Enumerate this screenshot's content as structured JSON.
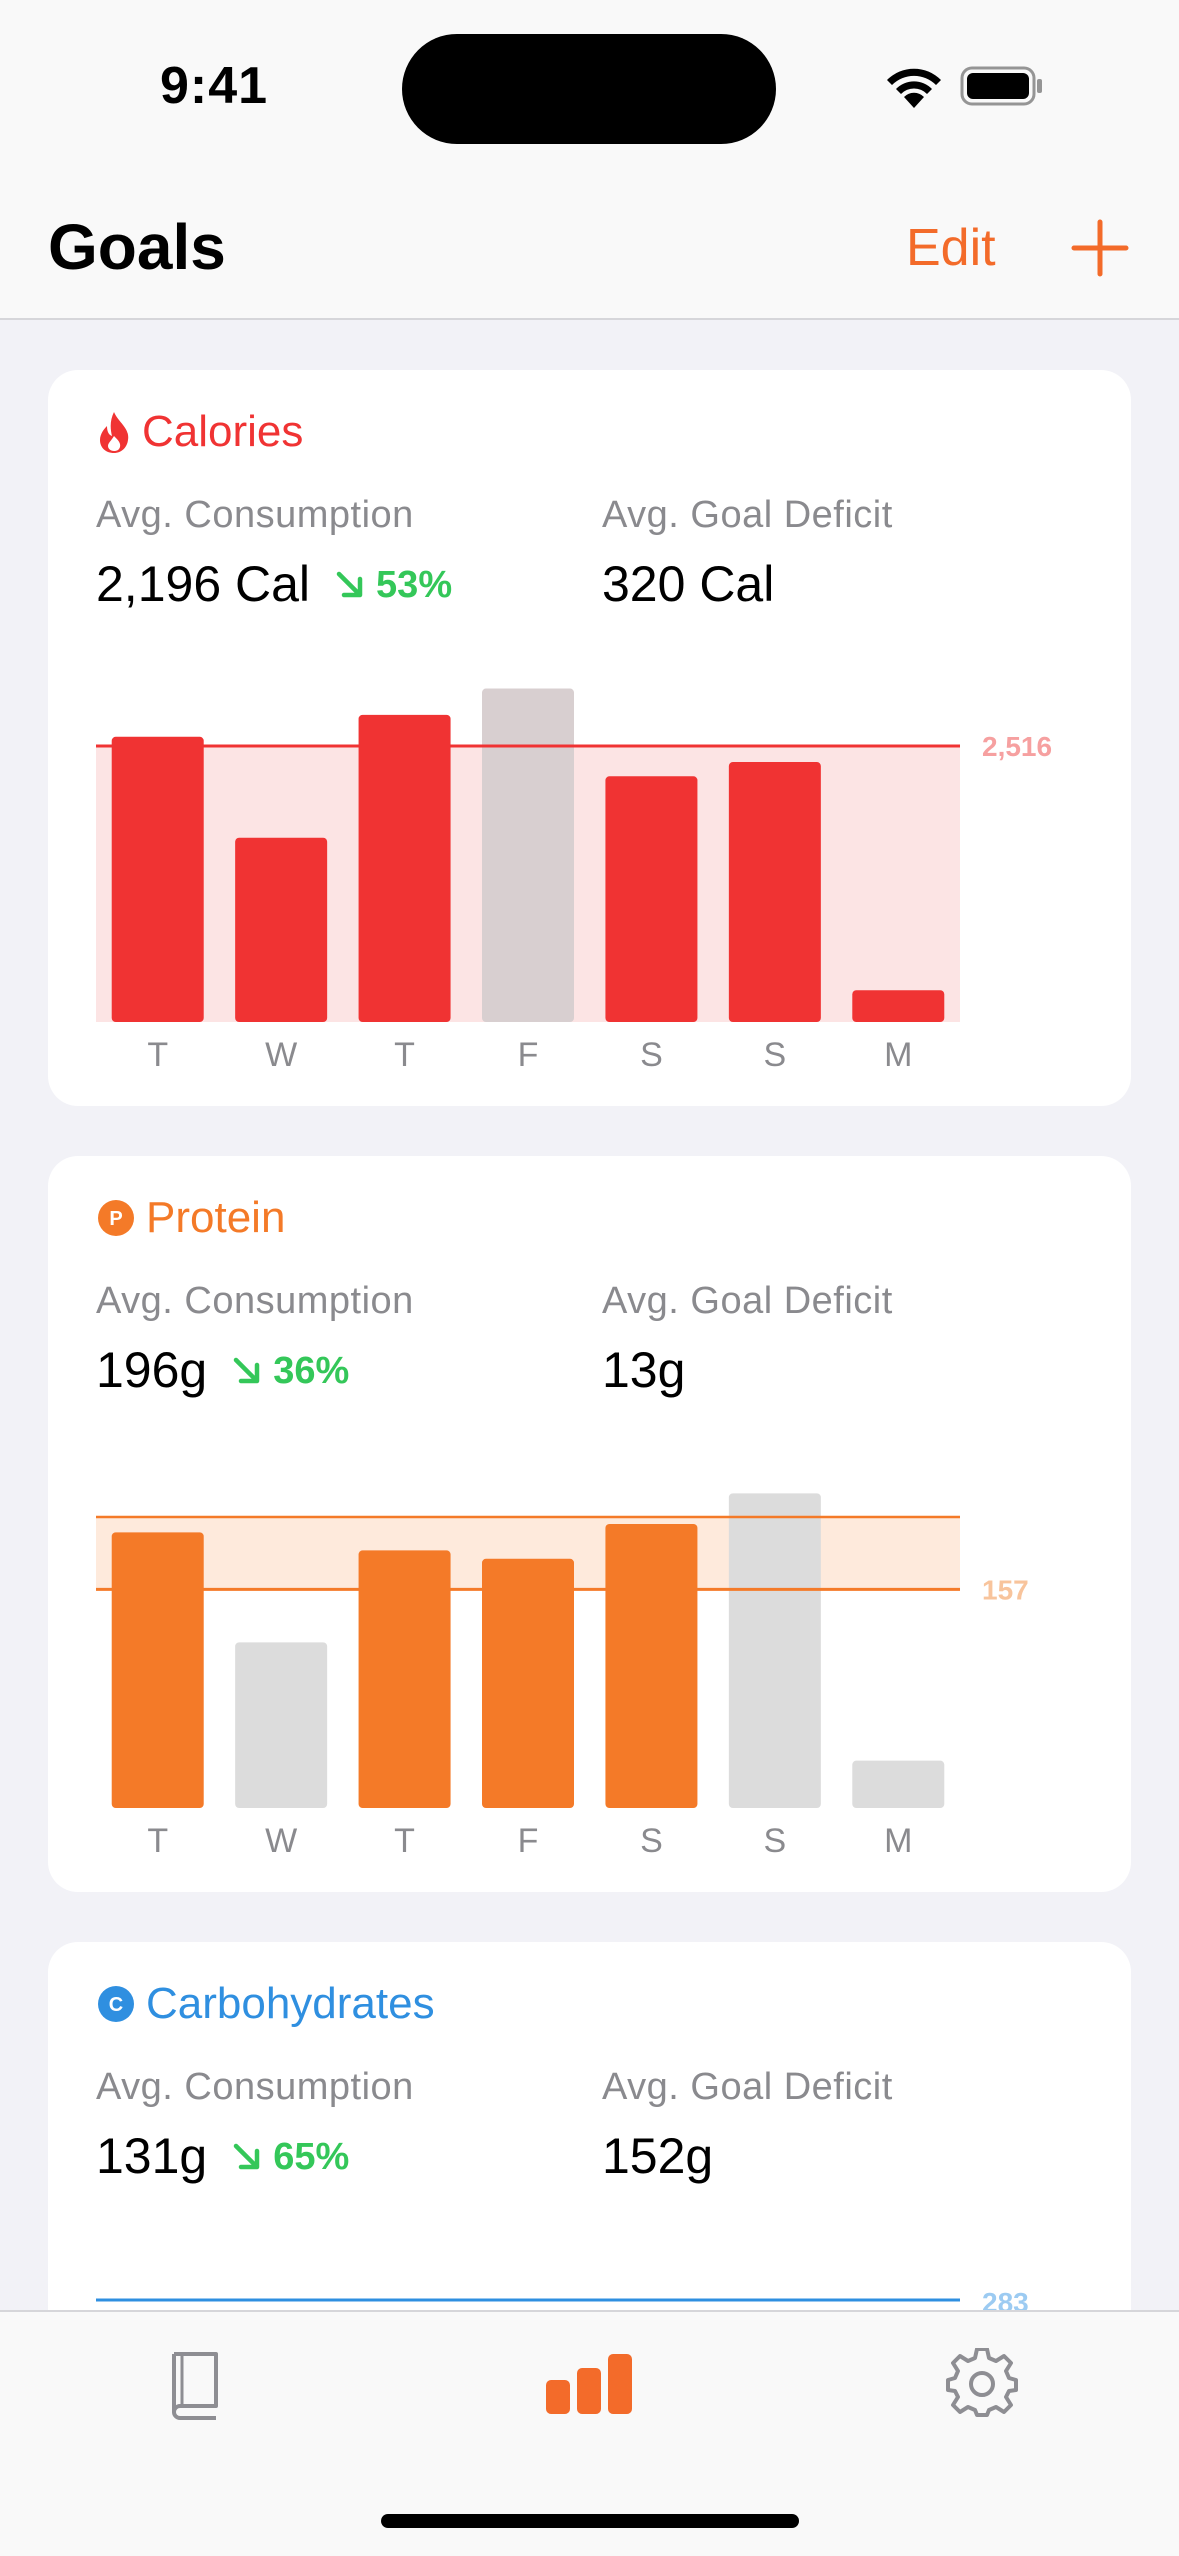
{
  "status": {
    "time": "9:41"
  },
  "nav": {
    "title": "Goals",
    "edit_label": "Edit"
  },
  "colors": {
    "accent": "#f36b2a",
    "calories": "#f03333",
    "protein": "#f47a28",
    "carbs": "#2f8fe0",
    "trend": "#34c759",
    "bar_off": "#dcdcdc"
  },
  "cards": [
    {
      "title": "Calories",
      "icon": "flame-icon",
      "consumption_label": "Avg. Consumption",
      "consumption_value": "2,196 Cal",
      "trend": "53%",
      "deficit_label": "Avg. Goal Deficit",
      "deficit_value": "320 Cal"
    },
    {
      "title": "Protein",
      "icon": "protein-p-icon",
      "consumption_label": "Avg. Consumption",
      "consumption_value": "196g",
      "trend": "36%",
      "deficit_label": "Avg. Goal Deficit",
      "deficit_value": "13g"
    },
    {
      "title": "Carbohydrates",
      "icon": "carbs-c-icon",
      "consumption_label": "Avg. Consumption",
      "consumption_value": "131g",
      "trend": "65%",
      "deficit_label": "Avg. Goal Deficit",
      "deficit_value": "152g"
    }
  ],
  "chart_data": [
    {
      "type": "bar",
      "categories": [
        "T",
        "W",
        "T",
        "F",
        "S",
        "S",
        "M"
      ],
      "values": [
        2600,
        1680,
        2800,
        3040,
        2240,
        2370,
        290
      ],
      "met": [
        true,
        true,
        true,
        false,
        true,
        true,
        true
      ],
      "goal_label": "2,516",
      "goal": 2516,
      "ylim": [
        0,
        3300
      ]
    },
    {
      "type": "bar",
      "categories": [
        "T",
        "W",
        "T",
        "F",
        "S",
        "S",
        "M"
      ],
      "values": [
        198,
        119,
        185,
        179,
        204,
        226,
        34
      ],
      "met": [
        true,
        false,
        true,
        true,
        true,
        false,
        false
      ],
      "goal_label": "157",
      "goal": 157,
      "goal_upper": 209,
      "ylim": [
        0,
        260
      ]
    },
    {
      "goal_label": "283"
    }
  ],
  "tabbar": {
    "items": [
      "book-icon",
      "chart-bars-icon",
      "gear-icon"
    ],
    "selected": 1
  }
}
